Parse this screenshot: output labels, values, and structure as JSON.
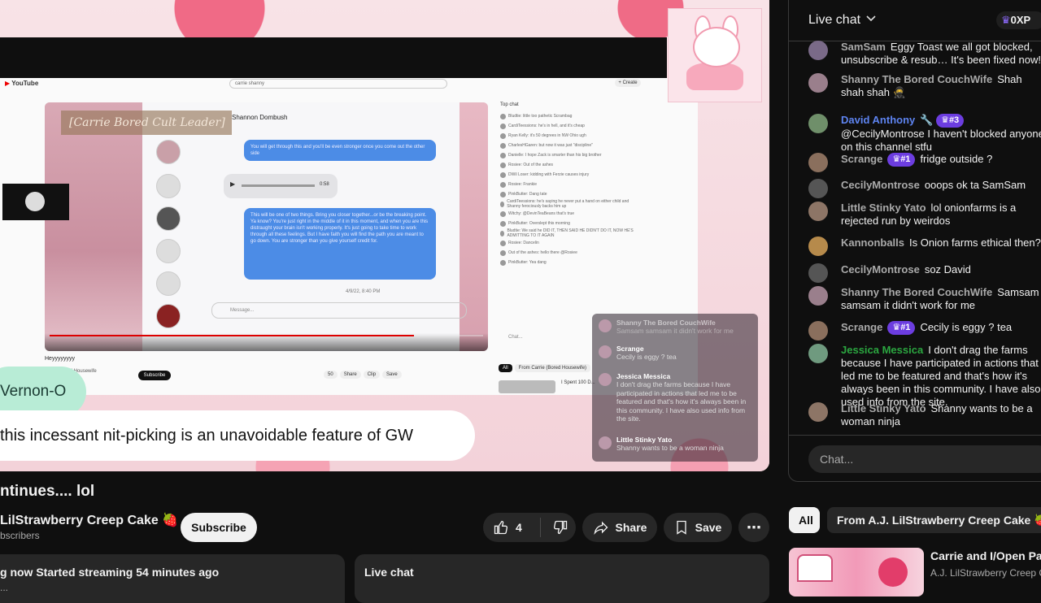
{
  "player": {
    "inner_app_name": "YouTube",
    "inner_search_value": "carrie shanny",
    "inner_create_label": "+ Create",
    "inner_banner": "[Carrie Bored Cult Leader]",
    "inner_contact_name": "Shannon Dombush",
    "inner_bubble_1": "You will get through this and you'll be even stronger once you come out the other side",
    "inner_audio_time": "0:58",
    "inner_bubble_2": "This will be one of two things. Bring you closer together...or be the breaking point. Ya know? You're just right in the middle of it in this moment, and when you are this distraught your brain isn't working properly. It's just going to take time to work through all these feelings. But I have faith you will find the path you are meant to go down. You are stronger than you give yourself credit for.",
    "inner_date": "4/9/22, 8:40 PM",
    "inner_message_placeholder": "Message...",
    "inner_chat_title": "Top chat",
    "inner_chat_rows": [
      "Bludtie: little too pathetic Scrambag",
      "CardiTeessions: he's in hell, and it's cheap",
      "Ryan Kelly: it's 50 degrees in NW Ohio ugh",
      "CharlesHGaren: but now it was just \"discipline\"",
      "Danielle: I hope Zack is smarter than his big brother",
      "Rosiee: Out of the ashes",
      "DWil Loser: kidding with Ferzie causes injury",
      "Rosiee: Frankie",
      "PinkButter: Dang tate",
      "CardiTeessions: he's saying he never put a hand on either child and Shanny ferociously backs him up",
      "Witchy: @DevinTeaBeans that's true",
      "PinkButter: Overslept this morning",
      "Bludtie: We said he DID IT, THEN SAID HE DIDN'T DO IT, NOW HE'S ADMITTING TO IT AGAIN",
      "Rosiee: Dancelin",
      "Out of the ashes: hello there @Rosiee",
      "PinkButter: Yea dang"
    ],
    "inner_chat_placeholder": "Chat...",
    "inner_video_owner": "Carrie Bored Housewife",
    "inner_video_caption": "Heyyyyyyyy",
    "inner_subscribe": "Subscribe",
    "inner_actions": [
      "50",
      "Share",
      "Clip",
      "Save"
    ],
    "inner_tabs": [
      "All",
      "From Carrie (Bored Housewife)"
    ],
    "inner_related": "I Spent 100 D...",
    "overlay_messages": [
      {
        "author": "Shanny The Bored CouchWife",
        "text": "Samsam samsam it didn't work for me"
      },
      {
        "author": "Scrange",
        "text": "Cecily is eggy ? tea"
      },
      {
        "author": "Jessica Messica",
        "text": "I don't drag the farms because I have participated in actions that led me to be featured and that's how it's always been in this community. I have also used info from the site."
      },
      {
        "author": "Little Stinky Yato",
        "text": "Shanny wants to be a woman ninja"
      }
    ],
    "name_pill": "Vernon-O",
    "caption": "this incessant nit-picking is an unavoidable feature of GW"
  },
  "video": {
    "title": "ntinues.... lol",
    "channel": "LilStrawberry Creep Cake 🍓",
    "subscribers": "bscribers",
    "subscribe_label": "Subscribe",
    "likes": "4",
    "share_label": "Share",
    "save_label": "Save",
    "more_label": "⋯",
    "status_line": "g now  Started streaming 54 minutes ago",
    "status_sub": "...",
    "live_chat_label": "Live chat"
  },
  "chat": {
    "title": "Live chat",
    "xp": "0XP",
    "input_placeholder": "Chat...",
    "messages": [
      {
        "author": "SamSam",
        "type": "normal",
        "rank": "",
        "text": "Eggy Toast we all got blocked, unsubscribe & resub… It's been fixed now!",
        "color": "#7a6a88"
      },
      {
        "author": "Shanny The Bored CouchWife",
        "type": "normal",
        "rank": "",
        "text": "Shah shah shah 🥷",
        "color": "#9a7f8c"
      },
      {
        "author": "David Anthony",
        "type": "mod",
        "rank": "#3",
        "text": "@CecilyMontrose I haven't blocked anyone on this channel stfu",
        "color": "#6f8f6a"
      },
      {
        "author": "Scrange",
        "type": "normal",
        "rank": "#1",
        "text": "fridge outside ?",
        "color": "#8a6f5d"
      },
      {
        "author": "CecilyMontrose",
        "type": "normal",
        "rank": "",
        "text": "ooops ok ta SamSam",
        "color": "#555555"
      },
      {
        "author": "Little Stinky Yato",
        "type": "normal",
        "rank": "",
        "text": "lol onionfarms is a rejected run by weirdos",
        "color": "#8d7566"
      },
      {
        "author": "Kannonballs",
        "type": "normal",
        "rank": "",
        "text": "Is Onion farms ethical then?",
        "color": "#b68a4b"
      },
      {
        "author": "CecilyMontrose",
        "type": "normal",
        "rank": "",
        "text": "soz David",
        "color": "#555555"
      },
      {
        "author": "Shanny The Bored CouchWife",
        "type": "normal",
        "rank": "",
        "text": "Samsam samsam it didn't work for me",
        "color": "#9a7f8c"
      },
      {
        "author": "Scrange",
        "type": "normal",
        "rank": "#1",
        "text": "Cecily is eggy ? tea",
        "color": "#8a6f5d"
      },
      {
        "author": "Jessica Messica",
        "type": "member",
        "rank": "",
        "text": "I don't drag the farms because I have participated in actions that led me to be featured and that's how it's always been in this community. I have also used info from the site.",
        "color": "#6f9a7f"
      },
      {
        "author": "Little Stinky Yato",
        "type": "normal",
        "rank": "",
        "text": "Shanny wants to be a woman ninja",
        "color": "#8d7566"
      }
    ]
  },
  "related": {
    "chip_all": "All",
    "chip_from": "From A.J. LilStrawberry Creep Cake 🍓",
    "item_title": "Carrie and I/Open Pan",
    "item_channel": "A.J. LilStrawberry Creep C"
  }
}
